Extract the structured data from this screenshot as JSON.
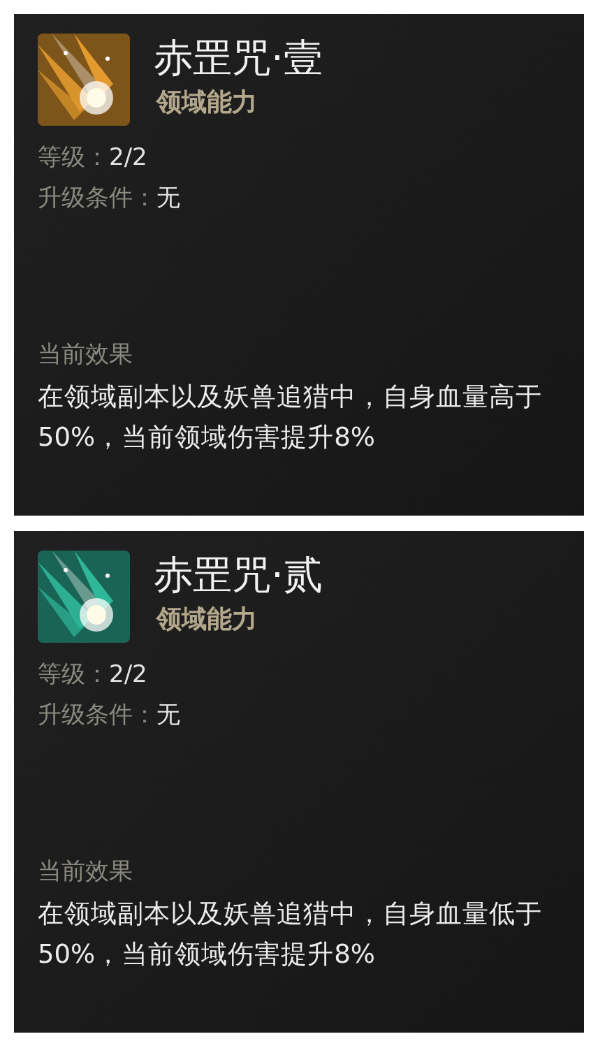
{
  "cards": [
    {
      "title": "赤罡咒·壹",
      "category": "领域能力",
      "color": "#e39a2e",
      "stats": [
        {
          "label": "等级：",
          "value": "2/2"
        },
        {
          "label": "升级条件：",
          "value": "无"
        }
      ],
      "effect_heading": "当前效果",
      "effect": "在领域副本以及妖兽追猎中，自身血量高于50%，当前领域伤害提升8%"
    },
    {
      "title": "赤罡咒·贰",
      "category": "领域能力",
      "color": "#2fb79a",
      "stats": [
        {
          "label": "等级：",
          "value": "2/2"
        },
        {
          "label": "升级条件：",
          "value": "无"
        }
      ],
      "effect_heading": "当前效果",
      "effect": "在领域副本以及妖兽追猎中，自身血量低于50%，当前领域伤害提升8%"
    }
  ]
}
